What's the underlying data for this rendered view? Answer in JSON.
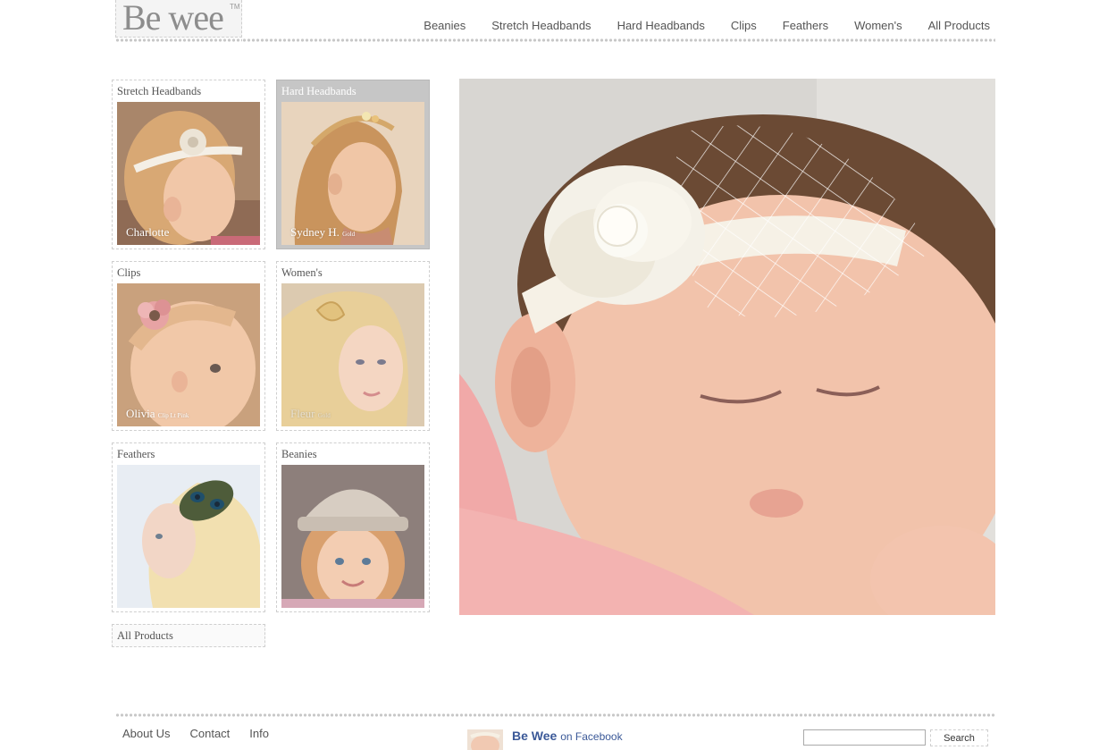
{
  "brand": {
    "logo_text": "Be wee",
    "logo_mark": "TM"
  },
  "topnav": {
    "items": [
      "Beanies",
      "Stretch Headbands",
      "Hard Headbands",
      "Clips",
      "Feathers",
      "Women's",
      "All Products"
    ]
  },
  "categories": [
    {
      "title": "Stretch Headbands",
      "caption": "Charlotte",
      "caption_small": "",
      "active": false,
      "image": "toddler-with-beaded-flower-headband"
    },
    {
      "title": "Hard Headbands",
      "caption": "Sydney H.",
      "caption_small": "Gold",
      "active": true,
      "image": "girl-with-gold-hard-headband"
    },
    {
      "title": "Clips",
      "caption": "Olivia",
      "caption_small": "Clip Lt Pink",
      "active": false,
      "image": "baby-with-pink-flower-clip"
    },
    {
      "title": "Women's",
      "caption": "Fleur",
      "caption_small": "Gold",
      "active": false,
      "image": "woman-with-gold-hair-piece"
    },
    {
      "title": "Feathers",
      "caption": "",
      "caption_small": "",
      "active": false,
      "image": "woman-with-peacock-feather-clip"
    },
    {
      "title": "Beanies",
      "caption": "",
      "caption_small": "",
      "active": false,
      "image": "girl-in-crochet-beanie"
    }
  ],
  "all_products_label": "All Products",
  "hero": {
    "image": "sleeping-baby-with-flower-veil-headband"
  },
  "footer": {
    "links": [
      "About Us",
      "Contact",
      "Info"
    ],
    "facebook_brand": "Be Wee",
    "facebook_suffix": "on Facebook",
    "search_placeholder": "",
    "search_button": "Search"
  },
  "colors": {
    "nav_text": "#555555",
    "active_tile": "#c6c6c6",
    "dotted_rule": "#c8c8c8",
    "facebook_blue": "#3b5998"
  }
}
